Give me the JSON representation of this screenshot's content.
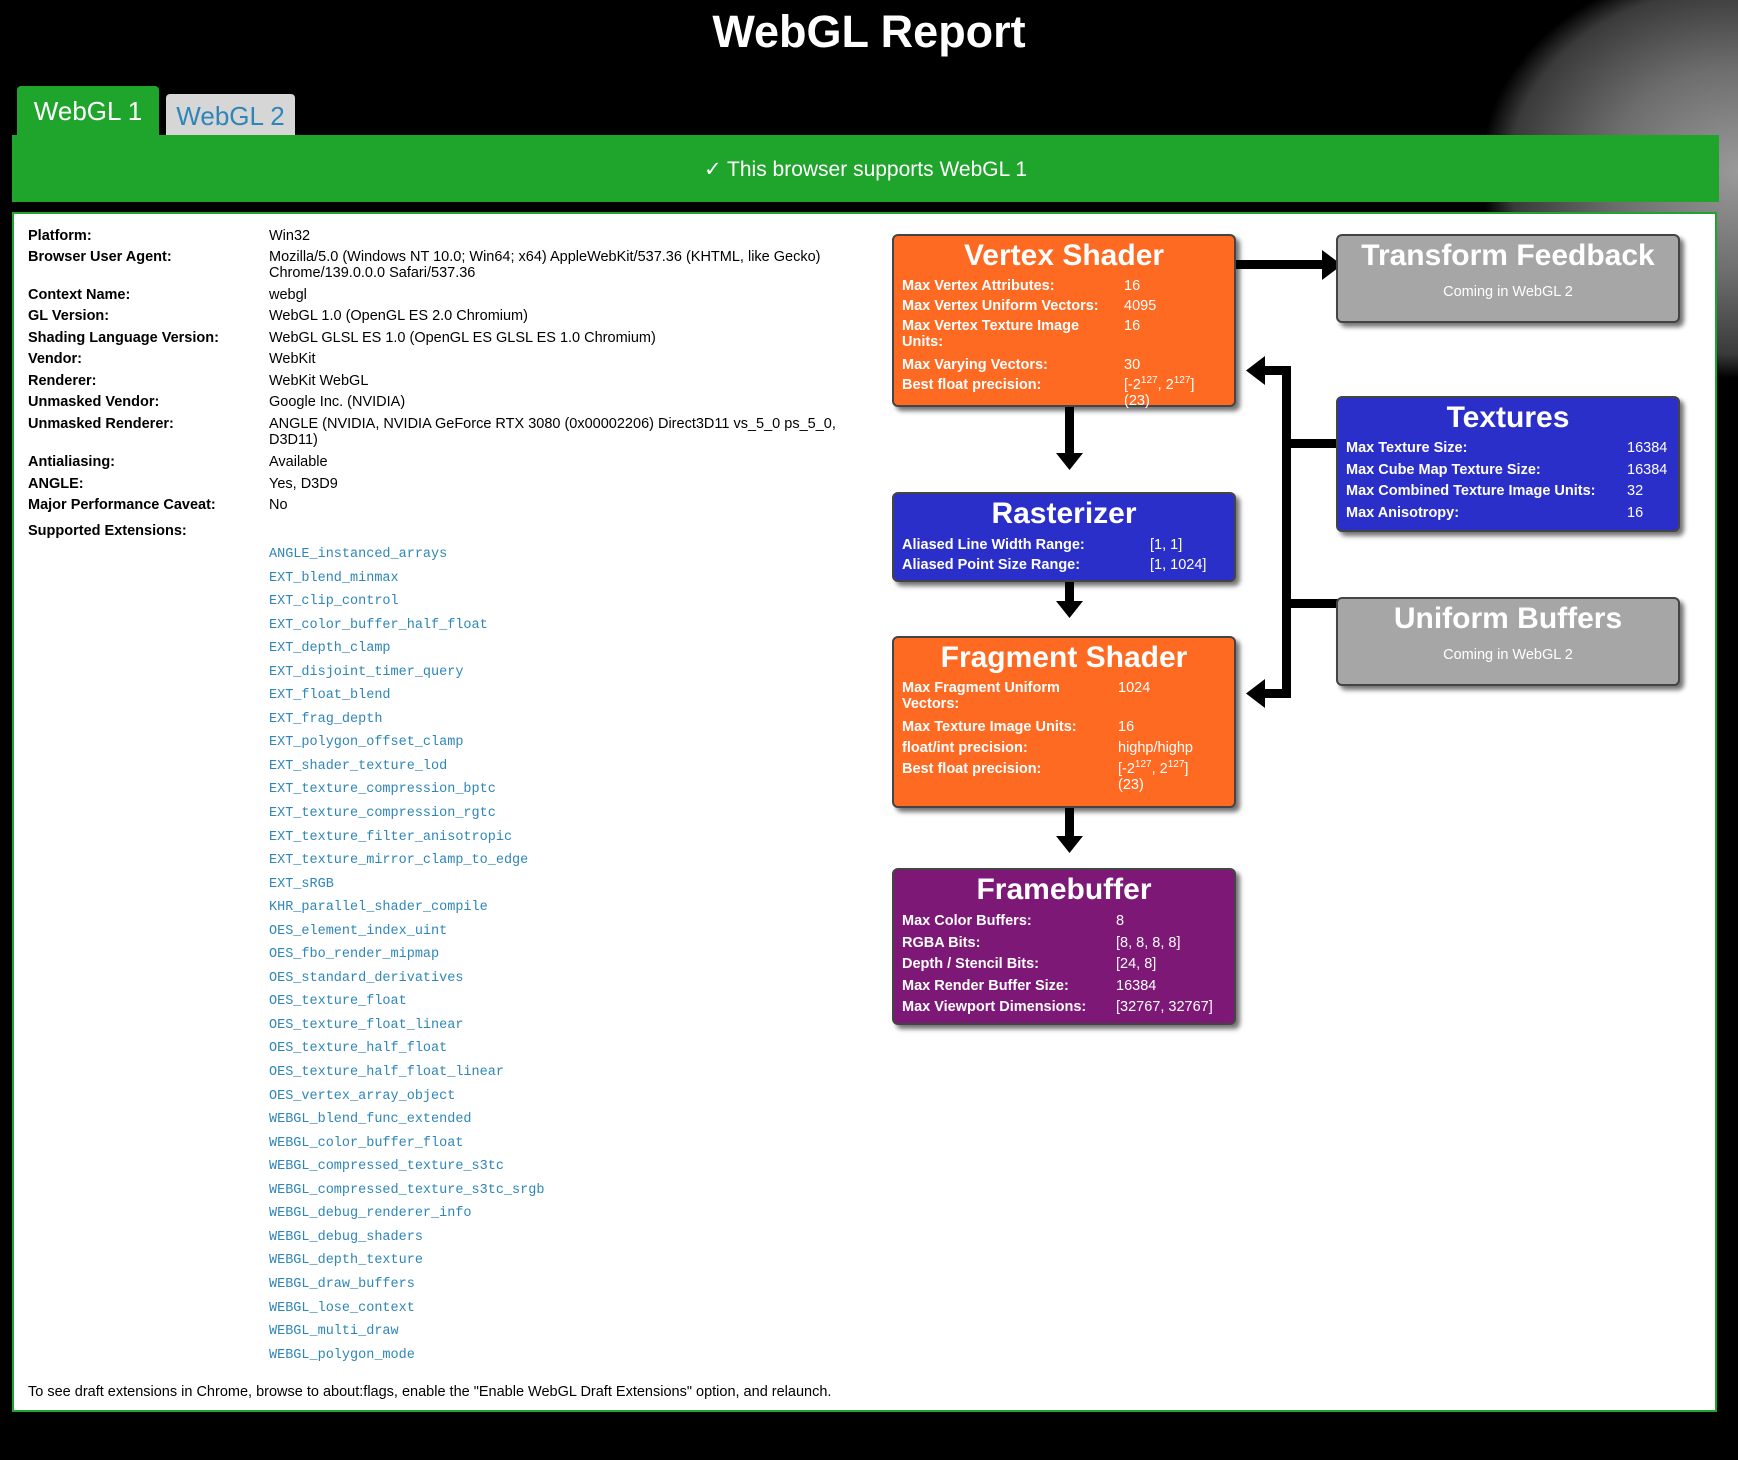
{
  "page": {
    "title": "WebGL Report"
  },
  "tabs": [
    {
      "label": "WebGL 1"
    },
    {
      "label": "WebGL 2"
    }
  ],
  "banner": {
    "text": "✓ This browser supports WebGL 1"
  },
  "info": [
    {
      "label": "Platform:",
      "value": "Win32"
    },
    {
      "label": "Browser User Agent:",
      "value": "Mozilla/5.0 (Windows NT 10.0; Win64; x64) AppleWebKit/537.36 (KHTML, like Gecko) Chrome/139.0.0.0 Safari/537.36"
    },
    {
      "label": "Context Name:",
      "value": "webgl"
    },
    {
      "label": "GL Version:",
      "value": "WebGL 1.0 (OpenGL ES 2.0 Chromium)"
    },
    {
      "label": "Shading Language Version:",
      "value": "WebGL GLSL ES 1.0 (OpenGL ES GLSL ES 1.0 Chromium)"
    },
    {
      "label": "Vendor:",
      "value": "WebKit"
    },
    {
      "label": "Renderer:",
      "value": "WebKit WebGL"
    },
    {
      "label": "Unmasked Vendor:",
      "value": "Google Inc. (NVIDIA)"
    },
    {
      "label": "Unmasked Renderer:",
      "value": "ANGLE (NVIDIA, NVIDIA GeForce RTX 3080 (0x00002206) Direct3D11 vs_5_0 ps_5_0, D3D11)"
    },
    {
      "label": "Antialiasing:",
      "value": "Available"
    },
    {
      "label": "ANGLE:",
      "value": "Yes, D3D9"
    },
    {
      "label": "Major Performance Caveat:",
      "value": "No"
    },
    {
      "label": "Supported Extensions:",
      "value": ""
    }
  ],
  "extensions": [
    "ANGLE_instanced_arrays",
    "EXT_blend_minmax",
    "EXT_clip_control",
    "EXT_color_buffer_half_float",
    "EXT_depth_clamp",
    "EXT_disjoint_timer_query",
    "EXT_float_blend",
    "EXT_frag_depth",
    "EXT_polygon_offset_clamp",
    "EXT_shader_texture_lod",
    "EXT_texture_compression_bptc",
    "EXT_texture_compression_rgtc",
    "EXT_texture_filter_anisotropic",
    "EXT_texture_mirror_clamp_to_edge",
    "EXT_sRGB",
    "KHR_parallel_shader_compile",
    "OES_element_index_uint",
    "OES_fbo_render_mipmap",
    "OES_standard_derivatives",
    "OES_texture_float",
    "OES_texture_float_linear",
    "OES_texture_half_float",
    "OES_texture_half_float_linear",
    "OES_vertex_array_object",
    "WEBGL_blend_func_extended",
    "WEBGL_color_buffer_float",
    "WEBGL_compressed_texture_s3tc",
    "WEBGL_compressed_texture_s3tc_srgb",
    "WEBGL_debug_renderer_info",
    "WEBGL_debug_shaders",
    "WEBGL_depth_texture",
    "WEBGL_draw_buffers",
    "WEBGL_lose_context",
    "WEBGL_multi_draw",
    "WEBGL_polygon_mode"
  ],
  "footnote": "To see draft extensions in Chrome, browse to about:flags, enable the \"Enable WebGL Draft Extensions\" option, and relaunch.",
  "pipeline": {
    "vertex_shader": {
      "title": "Vertex Shader",
      "rows": [
        {
          "label": "Max Vertex Attributes:",
          "value": "16"
        },
        {
          "label": "Max Vertex Uniform Vectors:",
          "value": "4095"
        },
        {
          "label": "Max Vertex Texture Image Units:",
          "value": "16"
        },
        {
          "label": "Max Varying Vectors:",
          "value": "30"
        },
        {
          "label": "Best float precision:",
          "value": "[-2^127, 2^127] (23)"
        }
      ]
    },
    "rasterizer": {
      "title": "Rasterizer",
      "rows": [
        {
          "label": "Aliased Line Width Range:",
          "value": "[1, 1]"
        },
        {
          "label": "Aliased Point Size Range:",
          "value": "[1, 1024]"
        }
      ]
    },
    "fragment_shader": {
      "title": "Fragment Shader",
      "rows": [
        {
          "label": "Max Fragment Uniform Vectors:",
          "value": "1024"
        },
        {
          "label": "Max Texture Image Units:",
          "value": "16"
        },
        {
          "label": "float/int precision:",
          "value": "highp/highp"
        },
        {
          "label": "Best float precision:",
          "value": "[-2^127, 2^127] (23)"
        }
      ]
    },
    "framebuffer": {
      "title": "Framebuffer",
      "rows": [
        {
          "label": "Max Color Buffers:",
          "value": "8"
        },
        {
          "label": "RGBA Bits:",
          "value": "[8, 8, 8, 8]"
        },
        {
          "label": "Depth / Stencil Bits:",
          "value": "[24, 8]"
        },
        {
          "label": "Max Render Buffer Size:",
          "value": "16384"
        },
        {
          "label": "Max Viewport Dimensions:",
          "value": "[32767, 32767]"
        }
      ]
    },
    "transform_feedback": {
      "title": "Transform Feedback",
      "note": "Coming in WebGL 2"
    },
    "textures": {
      "title": "Textures",
      "rows": [
        {
          "label": "Max Texture Size:",
          "value": "16384"
        },
        {
          "label": "Max Cube Map Texture Size:",
          "value": "16384"
        },
        {
          "label": "Max Combined Texture Image Units:",
          "value": "32"
        },
        {
          "label": "Max Anisotropy:",
          "value": "16"
        }
      ]
    },
    "uniform_buffers": {
      "title": "Uniform Buffers",
      "note": "Coming in WebGL 2"
    }
  },
  "colors": {
    "success_green": "#1fa52b",
    "shader_orange": "#ff6a22",
    "stage_blue": "#2b2fc9",
    "framebuffer_purple": "#7e1877",
    "disabled_gray": "#a6a6a6",
    "link_blue": "#2e86b8"
  }
}
